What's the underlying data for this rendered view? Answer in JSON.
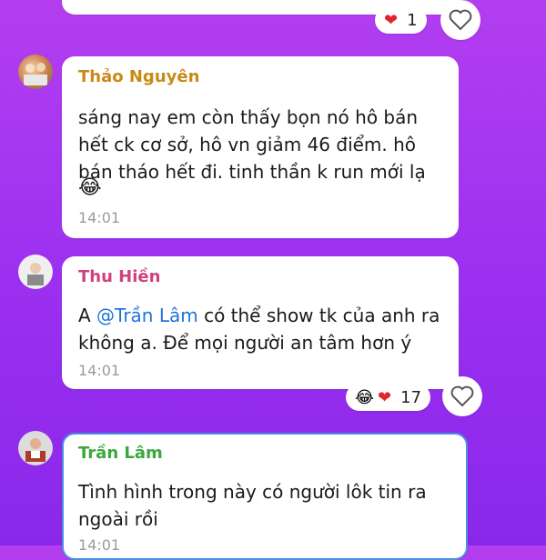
{
  "colors": {
    "background_top": "#b33ef0",
    "background_bottom": "#8a28ea",
    "name_thao": "#c98a16",
    "name_thu": "#d1427c",
    "name_tran": "#3aa83a",
    "mention": "#1e74d9",
    "selected_border": "#4a90e2"
  },
  "messages": [
    {
      "text_line": "",
      "reactions": [
        "red-heart-icon"
      ],
      "reaction_count": "1"
    },
    {
      "author": "Thảo Nguyên",
      "line1": "sáng nay em còn thấy bọn nó hô bán",
      "line2": "hết ck cơ sở, hô vn giảm 46 điểm. hô",
      "line3": "bán tháo hết đi. tinh thần k run mới lạ",
      "emoji": "😂",
      "time": "14:01"
    },
    {
      "author": "Thu Hiền",
      "prefix": "A ",
      "mention": "@Trần Lâm",
      "line1_rest": " có thể show tk của anh ra",
      "line2": "không a. Để mọi người an tâm hơn ý",
      "time": "14:01",
      "reactions": [
        "laughing-face-icon",
        "red-heart-icon"
      ],
      "reaction_count": "17"
    },
    {
      "author": "Trần Lâm",
      "line1": "Tình hình trong này có người lôk tin ra",
      "line2": "ngoài rồi",
      "time": "14:01"
    }
  ]
}
